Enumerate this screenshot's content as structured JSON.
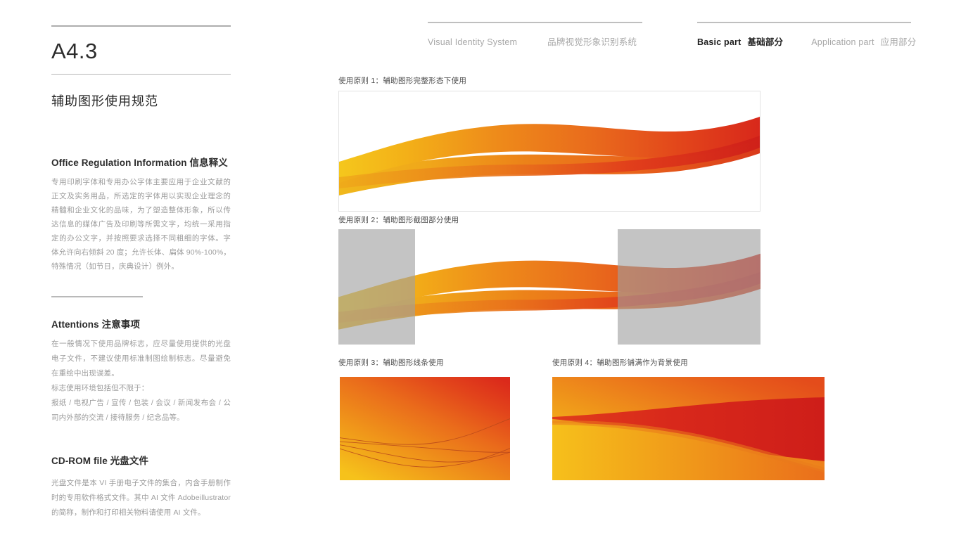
{
  "document": {
    "chapter_code": "A4.3",
    "chapter_title": "辅助图形使用规范"
  },
  "header": {
    "group_left": {
      "en": "Visual Identity System",
      "cn": "品牌视觉形象识别系统"
    },
    "group_right": {
      "basic_en": "Basic part",
      "basic_cn": "基础部分",
      "application_en": "Application part",
      "application_cn": "应用部分"
    }
  },
  "sections": [
    {
      "heading_en": "Office Regulation Information",
      "heading_cn": "信息释义",
      "heading": "Office Regulation Information 信息释义",
      "body": "专用印刷字体和专用办公字体主要应用于企业文献的正文及实务用品，所选定的字体用以实现企业理念的精髓和企业文化的品味，为了塑造整体形象，所以传达信息的媒体广告及印刷等所需文字，均统一采用指定的办公文字，并按照要求选择不同粗细的字体。字体允许向右倾斜 20 度；允许长体、扁体 90%-100%，特殊情况（如节日，庆典设计）例外。"
    },
    {
      "heading_en": "Attentions",
      "heading_cn": "注意事项",
      "heading": "Attentions 注意事项",
      "body": "在一般情况下使用品牌标志，应尽量使用提供的光盘电子文件，不建议使用标准制图绘制标志。尽量避免在重绘中出现误差。",
      "body2": "标志使用环境包括但不限于：",
      "body3": "报纸 / 电视广告 / 宣传 / 包装 / 会议 / 新闻发布会 / 公司内外部的交流 / 接待服务 / 纪念品等。"
    },
    {
      "heading_en": "CD-ROM file",
      "heading_cn": "光盘文件",
      "heading": "CD-ROM file 光盘文件",
      "body": "光盘文件是本 VI 手册电子文件的集合，内含手册制作时的专用软件格式文件。其中 AI 文件 Adobeillustrator 的简称，制作和打印相关物料请使用 AI 文件。"
    }
  ],
  "panels": [
    {
      "caption": "使用原则 1：辅助图形完整形态下使用"
    },
    {
      "caption": "使用原则 2：辅助图形截图部分使用"
    },
    {
      "caption": "使用原则 3：辅助图形线条使用"
    },
    {
      "caption": "使用原则 4：辅助图形铺满作为背景使用"
    }
  ],
  "colors": {
    "yellow": "#F2B81B",
    "amber": "#F3A81A",
    "orange": "#E8661B",
    "deep_orange": "#E2541A",
    "red": "#D4231B",
    "dark_red": "#B8201A",
    "mask_gray": "#A0A0A0",
    "rule_gray": "#BFBFBF",
    "body_text": "#9B9B9B",
    "heading_text": "#2B2B2B"
  }
}
